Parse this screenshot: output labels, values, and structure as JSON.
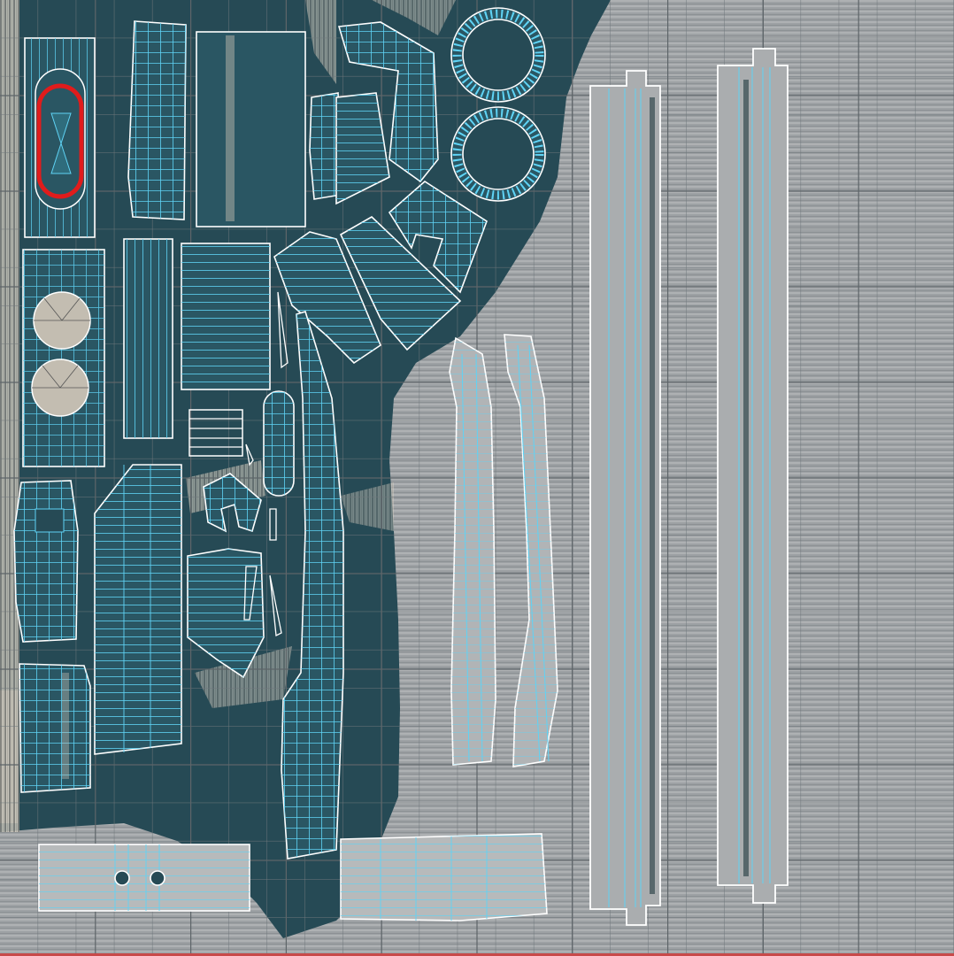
{
  "colors": {
    "background": "#9b9fa2",
    "teal_island": "#264a55",
    "teal_dark": "#1d3b45",
    "streak_light": "#c9c2b4",
    "grid_line": "#5d6468",
    "uv_border": "#ffffff",
    "uv_wire": "#5fd3f5",
    "selected_edge": "#e01c1c",
    "strip_fill": "#a9acae"
  },
  "icons": {
    "selection": "selected-uv-loop-icon",
    "ring": "uv-ring-icon"
  }
}
